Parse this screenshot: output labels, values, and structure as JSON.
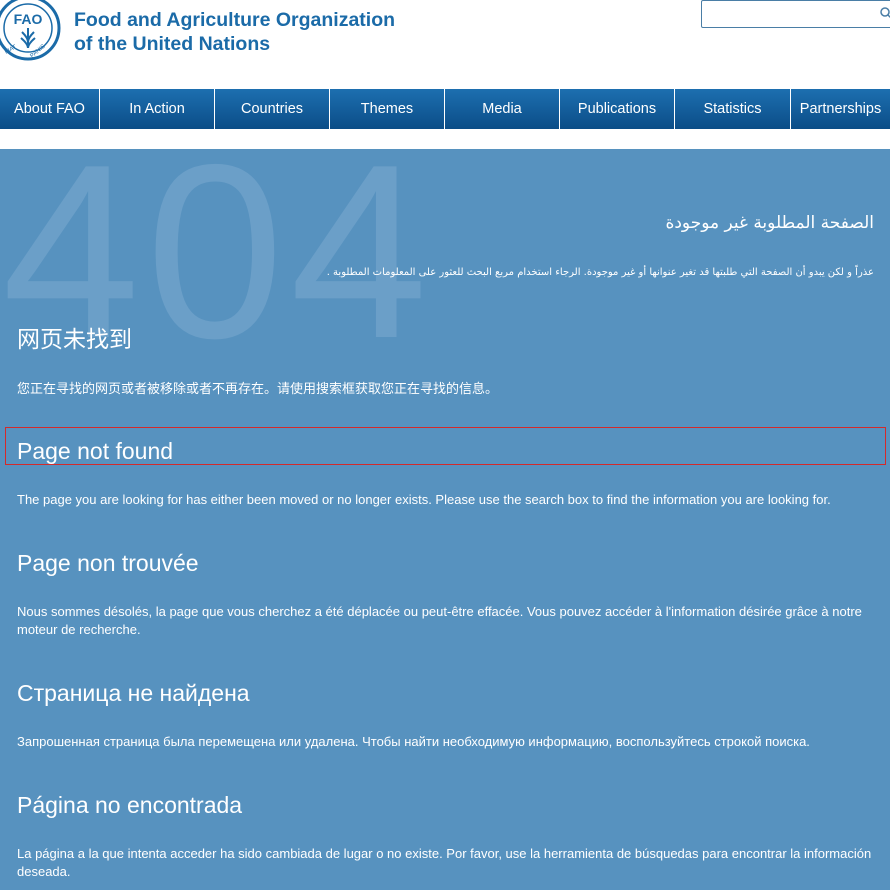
{
  "header": {
    "org_name_line1": "Food and Agriculture Organization",
    "org_name_line2": "of the United Nations",
    "logo_text": "FAO",
    "logo_motto": "FIAT PANIS",
    "search_placeholder": "",
    "colors": {
      "brand": "#1b6ba8",
      "search_border": "#4a7ea6"
    }
  },
  "nav": {
    "items": [
      {
        "label": "About FAO"
      },
      {
        "label": "In Action"
      },
      {
        "label": "Countries"
      },
      {
        "label": "Themes"
      },
      {
        "label": "Media"
      },
      {
        "label": "Publications"
      },
      {
        "label": "Statistics"
      },
      {
        "label": "Partnerships"
      }
    ],
    "colors": {
      "top": "#1d6fb0",
      "bottom": "#0b4d87"
    }
  },
  "main": {
    "big_number": "404",
    "colors": {
      "background": "#5792bf",
      "big_number": "#6b9fc8",
      "highlight_border": "#d42a2a"
    },
    "arabic": {
      "title": "الصفحة المطلوبة غير موجودة",
      "text": "عذراً و لكن يبدو أن الصفحة التي طلبتها قد تغير عنوانها أو غير موجودة. الرجاء استخدام مربع البحث للعثور على المعلومات المطلوبة ."
    },
    "chinese": {
      "title": "网页未找到",
      "text": "您正在寻找的网页或者被移除或者不再存在。请使用搜索框获取您正在寻找的信息。"
    },
    "english": {
      "title": "Page not found",
      "text": "The page you are looking for has either been moved or no longer exists. Please use the search box to find the information you are looking for."
    },
    "french": {
      "title": "Page non trouvée",
      "text": "Nous sommes désolés, la page que vous cherchez a été déplacée ou peut-être effacée. Vous pouvez accéder à l'information désirée grâce à notre moteur de recherche."
    },
    "russian": {
      "title": "Страница не найдена",
      "text": "Запрошенная страница была перемещена или удалена. Чтобы найти необходимую информацию, воспользуйтесь строкой поиска."
    },
    "spanish": {
      "title": "Página no encontrada",
      "text": "La página a la que intenta acceder ha sido cambiada de lugar o no existe. Por favor, use la herramienta de búsquedas para encontrar la información deseada."
    }
  }
}
